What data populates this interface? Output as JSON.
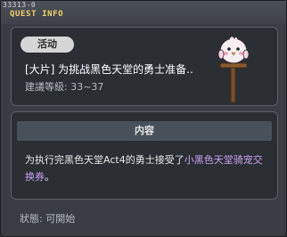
{
  "window": {
    "quest_id": "33313-0",
    "title": "QUEST INFO"
  },
  "quest": {
    "category": "活动",
    "name": "[大片] 为挑战黑色天堂的勇士准备..",
    "level_label": "建議等級: 33~37"
  },
  "content": {
    "header": "内容",
    "text_before": "为执行完黑色天堂Act4的勇士接受了",
    "text_highlight": "小黑色天堂骑宠交换券",
    "text_after": "。",
    "highlight_color": "#c9a0f0"
  },
  "status": {
    "label": "狀態: 可開始"
  },
  "icons": {
    "npc": "pink-chick-on-post-icon"
  }
}
